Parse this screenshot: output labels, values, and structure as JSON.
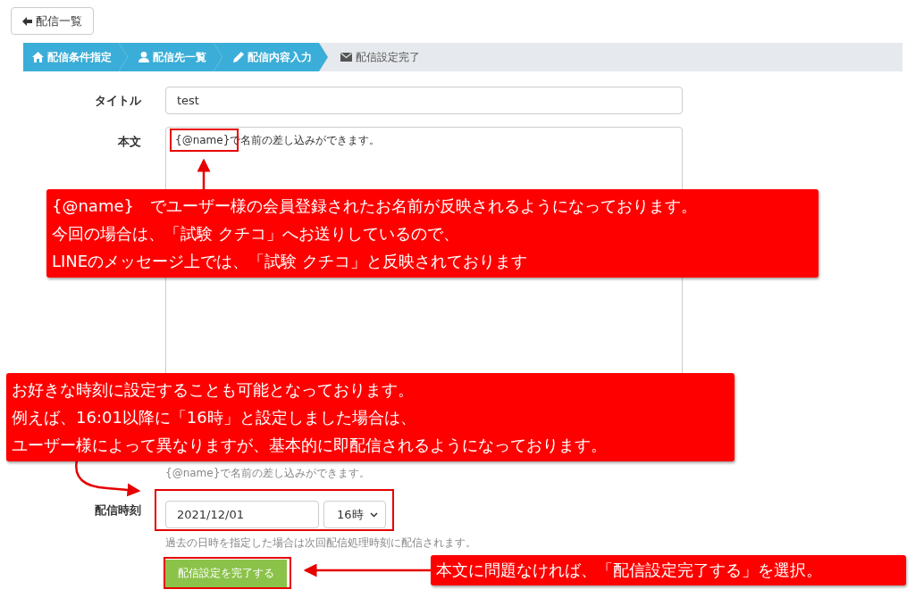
{
  "back_button": {
    "label": "配信一覧"
  },
  "steps": [
    {
      "label": "配信条件指定",
      "done": true
    },
    {
      "label": "配信先一覧",
      "done": true
    },
    {
      "label": "配信内容入力",
      "done": true
    },
    {
      "label": "配信設定完了",
      "done": false
    }
  ],
  "form": {
    "title_label": "タイトル",
    "title_value": "test",
    "body_label": "本文",
    "body_value": "{@name}で名前の差し込みができます。",
    "body_hint": "{@name}で名前の差し込みができます。",
    "time_label": "配信時刻",
    "date_value": "2021/12/01",
    "hour_value": "16時",
    "time_hint": "過去の日時を指定した場合は次回配信処理時刻に配信されます。",
    "submit": "配信設定を完了する"
  },
  "annotations": [
    {
      "lines": [
        "{@name}　でユーザー様の会員登録されたお名前が反映されるようになっております。",
        "今回の場合は、「試験 クチコ」へお送りしているので、",
        "LINEのメッセージ上では、「試験 クチコ」と反映されております"
      ]
    },
    {
      "lines": [
        "お好きな時刻に設定することも可能となっております。",
        "例えば、16:01以降に「16時」と設定しました場合は、",
        "ユーザー様によって異なりますが、基本的に即配信されるようになっております。"
      ]
    },
    {
      "lines": [
        "本文に問題なければ、「配信設定完了する」を選択。"
      ]
    }
  ]
}
